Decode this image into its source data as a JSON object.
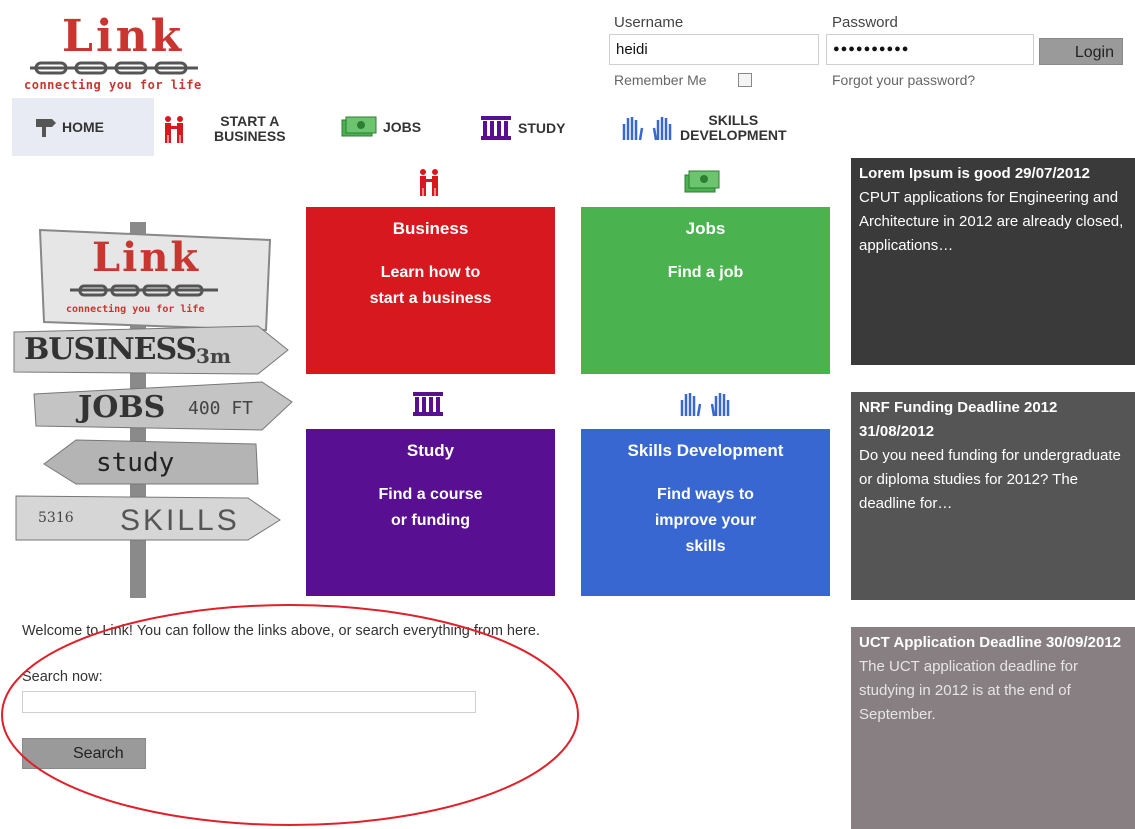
{
  "logo": {
    "word": "Link",
    "tagline": "connecting you for life"
  },
  "login": {
    "username_label": "Username",
    "username_value": "heidi",
    "password_label": "Password",
    "password_value": "●●●●●●●●●●",
    "login_button": "Login",
    "remember_label": "Remember Me",
    "forgot_link": "Forgot your password?"
  },
  "nav": {
    "home": "HOME",
    "business_line1": "START A",
    "business_line2": "BUSINESS",
    "jobs": "JOBS",
    "study": "STUDY",
    "skills_line1": "SKILLS",
    "skills_line2": "DEVELOPMENT"
  },
  "signpost": {
    "word": "Link",
    "tagline": "connecting you for life",
    "sign1": "BUSINESS",
    "sign1_dist": "3m",
    "sign2": "JOBS",
    "sign2_dist": "400 FT",
    "sign3": "study",
    "sign4_num": "5316",
    "sign4": "SKILLS"
  },
  "tiles": {
    "business": {
      "title": "Business",
      "line1": "Learn how to",
      "line2": "start a business"
    },
    "jobs": {
      "title": "Jobs",
      "line1": "Find a job"
    },
    "study": {
      "title": "Study",
      "line1": "Find a course",
      "line2": "or funding"
    },
    "skills": {
      "title": "Skills Development",
      "line1": "Find ways to",
      "line2": "improve your",
      "line3": "skills"
    }
  },
  "colors": {
    "business": "#d7181f",
    "jobs": "#4ab34f",
    "study": "#580f92",
    "skills": "#3867d2",
    "news1": "#3a3a3a",
    "news2": "#555555",
    "news3": "#877f82",
    "annotation": "#e0202a"
  },
  "news": [
    {
      "title": "Lorem Ipsum is good 29/07/2012",
      "body": "CPUT applications for Engineering and Architecture in 2012 are already closed, applications…"
    },
    {
      "title": "NRF Funding Deadline 2012 31/08/2012",
      "body": "Do you need funding for undergraduate or diploma studies for 2012? The deadline for…"
    },
    {
      "title": "UCT Application Deadline 30/09/2012",
      "body": "The UCT application deadline for studying in 2012 is at the end of September."
    }
  ],
  "welcome": "Welcome to Link! You can follow the links above, or search everything from here.",
  "search": {
    "label": "Search now:",
    "button": "Search",
    "value": ""
  }
}
